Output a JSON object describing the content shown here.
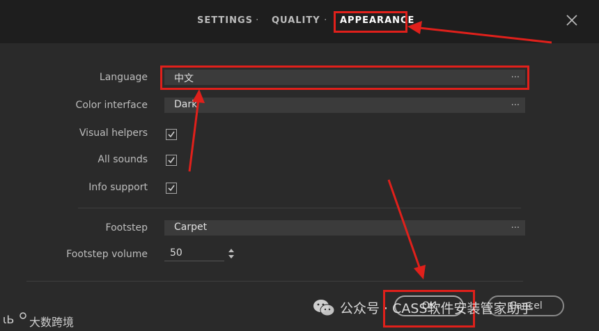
{
  "tabs": [
    {
      "label": "SETTINGS"
    },
    {
      "label": "QUALITY"
    },
    {
      "label": "APPEARANCE",
      "active": true
    }
  ],
  "tab_separator": "·",
  "settings": {
    "language": {
      "label": "Language",
      "value": "中文",
      "more": "..."
    },
    "color_interface": {
      "label": "Color interface",
      "value": "Dark",
      "more": "..."
    },
    "visual_helpers": {
      "label": "Visual helpers",
      "checked": true
    },
    "all_sounds": {
      "label": "All sounds",
      "checked": true
    },
    "info_support": {
      "label": "Info support",
      "checked": true
    },
    "footstep": {
      "label": "Footstep",
      "value": "Carpet",
      "more": "..."
    },
    "footstep_volume": {
      "label": "Footstep volume",
      "value": "50"
    }
  },
  "buttons": {
    "ok": "OK",
    "cancel": "Cancel"
  },
  "watermark": {
    "channel": "公众号 · CASS软件安装管家助手",
    "brand": "大数跨境"
  },
  "colors": {
    "annotation": "#e0201b",
    "background": "#2a2a2a",
    "topbar": "#1e1e1e"
  }
}
